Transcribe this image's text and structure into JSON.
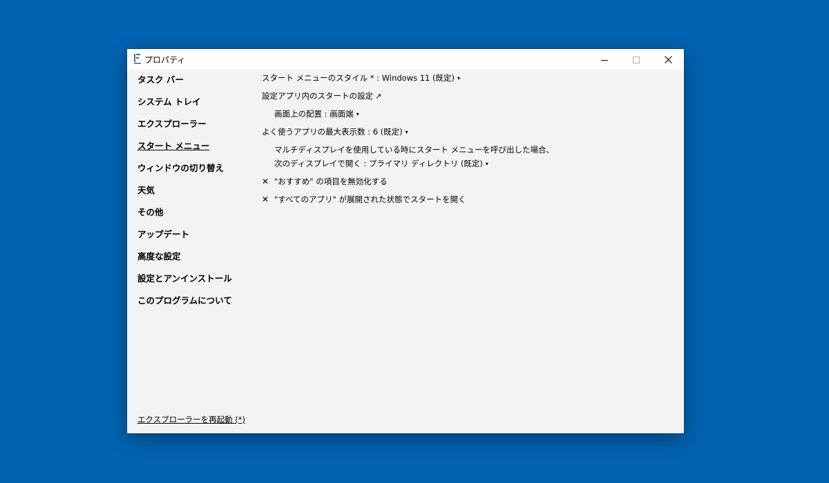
{
  "window": {
    "title": "プロパティ",
    "icon": "app-icon"
  },
  "titlebar_buttons": {
    "minimize": "minimize-icon",
    "maximize": "maximize-icon",
    "close": "close-icon"
  },
  "sidebar": {
    "items": [
      {
        "label": "タスク バー",
        "active": false
      },
      {
        "label": "システム トレイ",
        "active": false
      },
      {
        "label": "エクスプローラー",
        "active": false
      },
      {
        "label": "スタート メニュー",
        "active": true
      },
      {
        "label": "ウィンドウの切り替え",
        "active": false
      },
      {
        "label": "天気",
        "active": false
      },
      {
        "label": "その他",
        "active": false
      },
      {
        "label": "アップデート",
        "active": false
      },
      {
        "label": "高度な設定",
        "active": false
      },
      {
        "label": "設定とアンインストール",
        "active": false
      },
      {
        "label": "このプログラムについて",
        "active": false
      }
    ],
    "restart_link": "エクスプローラーを再起動 (*)"
  },
  "settings": {
    "start_menu_style": {
      "label": "スタート メニューのスタイル * : ",
      "value": "Windows 11 (既定)"
    },
    "settings_app_link": {
      "label": "設定アプリ内のスタートの設定",
      "icon": "↗"
    },
    "screen_position": {
      "label": "画面上の配置 : ",
      "value": "画面端"
    },
    "max_frequent_apps": {
      "label": "よく使うアプリの最大表示数 : ",
      "value": "6 (既定)"
    },
    "multi_display": {
      "line1": "マルチディスプレイを使用している時にスタート メニューを呼び出した場合、",
      "label": "次のディスプレイで開く : ",
      "value": "プライマリ ディレクトリ (既定)"
    },
    "disable_recommended": {
      "label": "\"おすすめ\" の項目を無効化する",
      "checked": true,
      "mark": "✕"
    },
    "open_all_apps": {
      "label": "\"すべてのアプリ\" が展開された状態でスタートを開く",
      "checked": true,
      "mark": "✕"
    },
    "caret": "▾",
    "colors": {
      "background": "#0063b1",
      "window": "#f3f3f3",
      "titlebar": "#ffffff"
    }
  }
}
